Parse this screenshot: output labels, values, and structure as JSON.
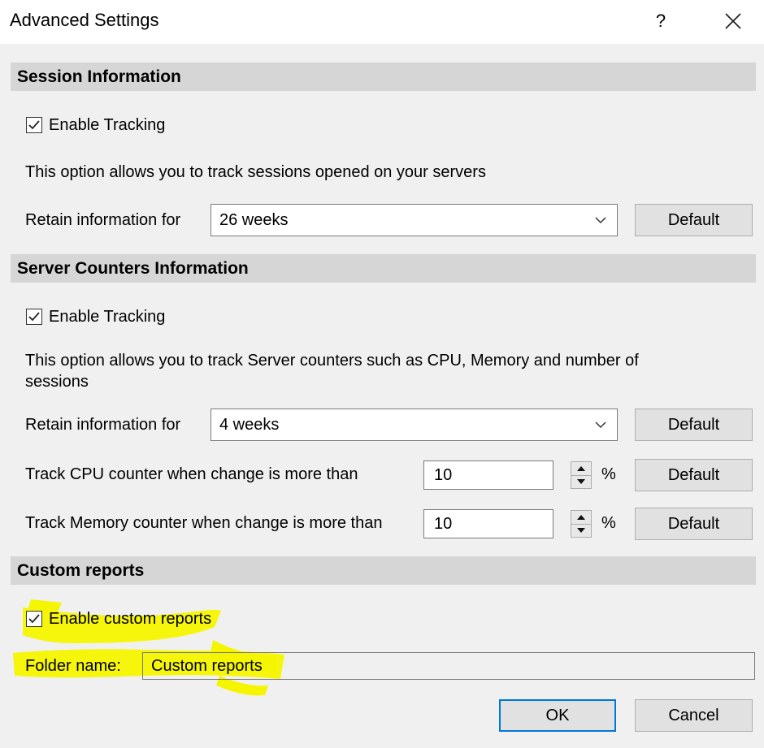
{
  "window": {
    "title": "Advanced Settings",
    "help_glyph": "?"
  },
  "session": {
    "header": "Session Information",
    "enable_label": "Enable Tracking",
    "enabled": true,
    "description": "This option allows you to track sessions opened on your servers",
    "retain_label": "Retain information for",
    "retain_value": "26 weeks",
    "default_label": "Default"
  },
  "counters": {
    "header": "Server Counters Information",
    "enable_label": "Enable Tracking",
    "enabled": true,
    "description_line1": "This option allows you to track Server counters such as CPU, Memory and number of",
    "description_line2": "sessions",
    "retain_label": "Retain information for",
    "retain_value": "4 weeks",
    "retain_default_label": "Default",
    "cpu_label": "Track CPU counter when change is more than",
    "cpu_value": "10",
    "cpu_unit": "%",
    "cpu_default_label": "Default",
    "mem_label": "Track Memory counter when change is more than",
    "mem_value": "10",
    "mem_unit": "%",
    "mem_default_label": "Default"
  },
  "custom": {
    "header": "Custom reports",
    "enable_label": "Enable custom reports",
    "enabled": true,
    "folder_label": "Folder name:",
    "folder_value": "Custom reports"
  },
  "footer": {
    "ok_label": "OK",
    "cancel_label": "Cancel"
  },
  "colors": {
    "focus_border": "#0078d7",
    "highlighter": "#f5f500",
    "section_bg": "#d6d6d6"
  }
}
